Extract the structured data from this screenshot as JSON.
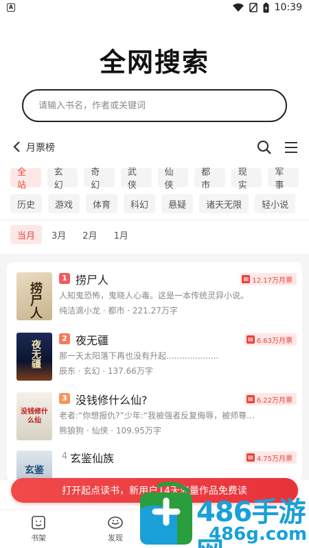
{
  "status_bar": {
    "time": "10:39",
    "app_icon": "A",
    "icons": [
      "wifi-icon",
      "no-signal-icon",
      "battery-icon"
    ]
  },
  "page": {
    "title": "全网搜索"
  },
  "search": {
    "placeholder": "请输入书名，作者或关键词"
  },
  "ranking": {
    "back_icon": "chevron-left-icon",
    "title": "月票榜",
    "tool_icons": [
      "search-icon",
      "menu-icon"
    ]
  },
  "categories": {
    "row1": [
      "全站",
      "玄幻",
      "奇幻",
      "武侠",
      "仙侠",
      "都市",
      "现实",
      "军事"
    ],
    "row2": [
      "历史",
      "游戏",
      "体育",
      "科幻",
      "悬疑",
      "诸天无限",
      "轻小说"
    ],
    "active": "全站"
  },
  "periods": {
    "items": [
      "当月",
      "3月",
      "2月",
      "1月"
    ],
    "active": "当月"
  },
  "books": [
    {
      "rank": "1",
      "title": "捞尸人",
      "tickets": "12.17万月票",
      "desc": "人知鬼恐怖，鬼晓人心毒。这是一本传统灵异小说。",
      "meta": "纯洁滴小龙 · 都市 · 221.27万字",
      "cover_text": "捞尸人"
    },
    {
      "rank": "2",
      "title": "夜无疆",
      "tickets": "6.63万月票",
      "desc": "那一天太阳落下再也没有升起....................",
      "meta": "辰东 · 玄幻 · 137.66万字",
      "cover_text": "夜无疆"
    },
    {
      "rank": "3",
      "title": "没钱修什么仙?",
      "tickets": "6.22万月票",
      "desc": "老者:“你想报仇?”少年:“我被强者反复侮辱，被师尊...",
      "meta": "熊狼狗 · 仙侠 · 109.95万字",
      "cover_text": "没钱修什么仙"
    },
    {
      "rank": "4",
      "title": "玄鉴仙族",
      "tickets": "4.75万月票",
      "desc": "",
      "meta": "",
      "cover_text": "玄鉴"
    }
  ],
  "promo": {
    "text": "打开起点读书，新用户14天海量作品免费读"
  },
  "tabbar": {
    "items": [
      "书架",
      "发现"
    ]
  },
  "watermark": {
    "text": "486手游网",
    "sub": "486g.com"
  },
  "colors": {
    "accent": "#e8443a",
    "accent_bg": "#fde8e8",
    "watermark": "#1aa0d8"
  }
}
